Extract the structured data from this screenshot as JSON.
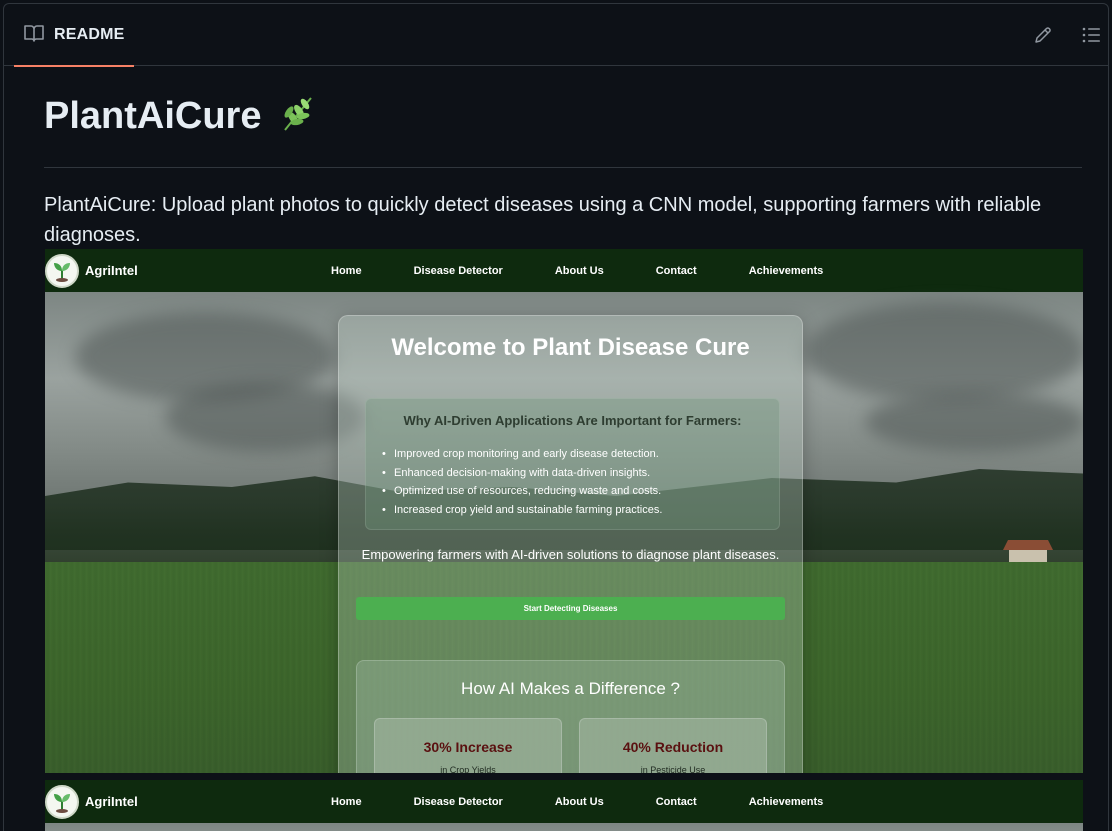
{
  "readme": {
    "tab_label": "README",
    "title": "PlantAiCure",
    "intro": "PlantAiCure: Upload plant photos to quickly detect diseases using a CNN model, supporting farmers with reliable diagnoses."
  },
  "app": {
    "brand": "AgriIntel",
    "nav": [
      "Home",
      "Disease Detector",
      "About Us",
      "Contact",
      "Achievements"
    ],
    "card_title": "Welcome to Plant Disease Cure",
    "why_title": "Why AI-Driven Applications Are Important for Farmers:",
    "why_items": [
      "Improved crop monitoring and early disease detection.",
      "Enhanced decision-making with data-driven insights.",
      "Optimized use of resources, reducing waste and costs.",
      "Increased crop yield and sustainable farming practices."
    ],
    "empower": "Empowering farmers with AI-driven solutions to diagnose plant diseases.",
    "start_button": "Start Detecting Diseases",
    "difference_title": "How AI Makes a Difference ?",
    "stats": [
      {
        "value": "30% Increase",
        "label": "in Crop Yields"
      },
      {
        "value": "40% Reduction",
        "label": "in Pesticide Use"
      }
    ]
  },
  "colors": {
    "accent_underline": "#f78166",
    "nav_bg": "#0e2a0e",
    "button_green": "#4caf50"
  }
}
